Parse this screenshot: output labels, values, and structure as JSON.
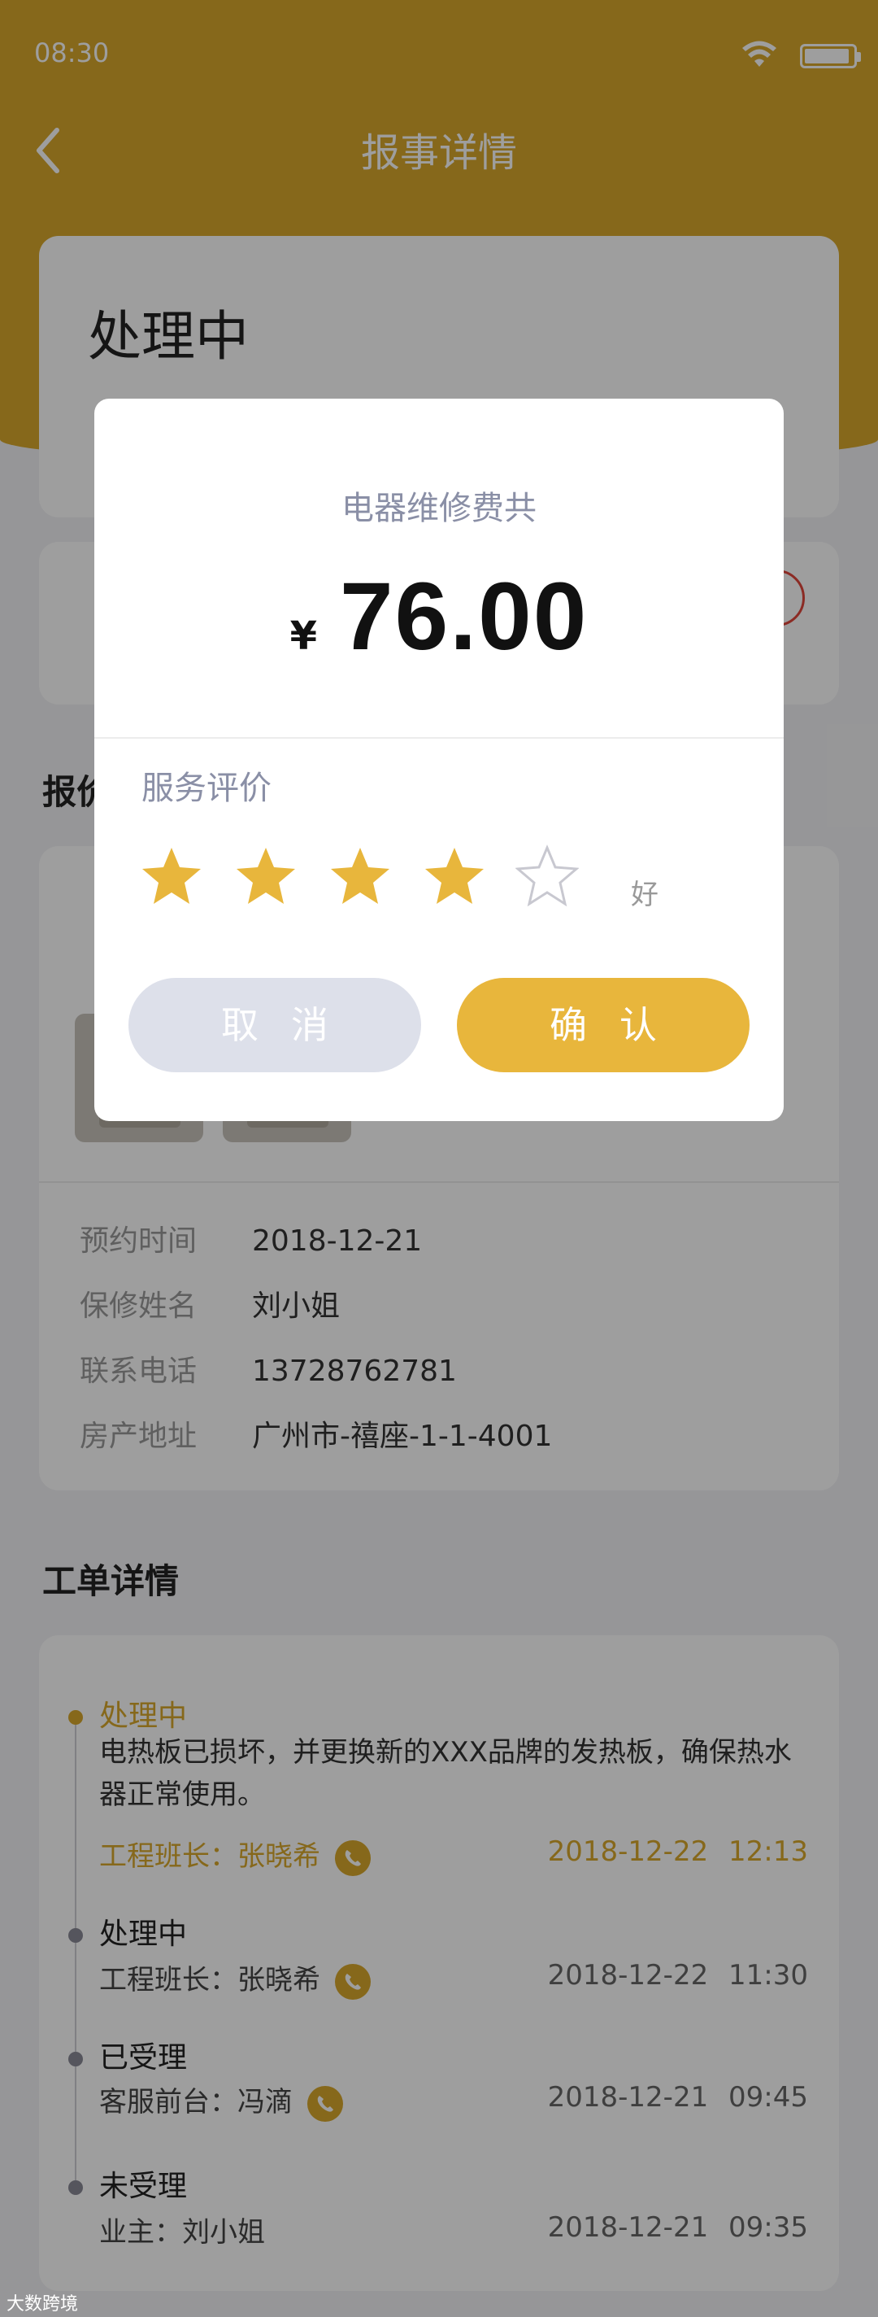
{
  "status_bar": {
    "time": "08:30"
  },
  "nav": {
    "title": "报事详情"
  },
  "status_card": {
    "title": "处理中"
  },
  "quote_section": {
    "title": "报价"
  },
  "quote_card": {
    "fields": [
      {
        "label": "预约时间",
        "value": "2018-12-21"
      },
      {
        "label": "保修姓名",
        "value": "刘小姐"
      },
      {
        "label": "联系电话",
        "value": "13728762781"
      },
      {
        "label": "房产地址",
        "value": "广州市-禧座-1-1-4001"
      }
    ]
  },
  "order_section": {
    "title": "工单详情"
  },
  "timeline": [
    {
      "status": "处理中",
      "desc": "电热板已损坏，并更换新的XXX品牌的发热板，确保热水器正常使用。",
      "person": "工程班长：张晓希",
      "time": "2018-12-22 12:13",
      "has_phone": true,
      "active": true
    },
    {
      "status": "处理中",
      "desc": "",
      "person": "工程班长：张晓希",
      "time": "2018-12-22 11:30",
      "has_phone": true,
      "active": false
    },
    {
      "status": "已受理",
      "desc": "",
      "person": "客服前台：冯滴",
      "time": "2018-12-21 09:45",
      "has_phone": true,
      "active": false
    },
    {
      "status": "未受理",
      "desc": "",
      "person": "业主：刘小姐",
      "time": "2018-12-21 09:35",
      "has_phone": false,
      "active": false
    }
  ],
  "modal": {
    "label": "电器维修费共",
    "currency": "¥",
    "amount": "76.00",
    "rating_label": "服务评价",
    "rating": 4,
    "rating_max": 5,
    "rating_text": "好",
    "cancel_label": "取消",
    "confirm_label": "确认"
  },
  "colors": {
    "accent": "#d8a82c",
    "button_confirm": "#e8b63c",
    "button_cancel": "#dde0ea",
    "star_filled": "#e8b63c",
    "star_empty": "#c8c8d0"
  },
  "watermark": "大数跨境"
}
